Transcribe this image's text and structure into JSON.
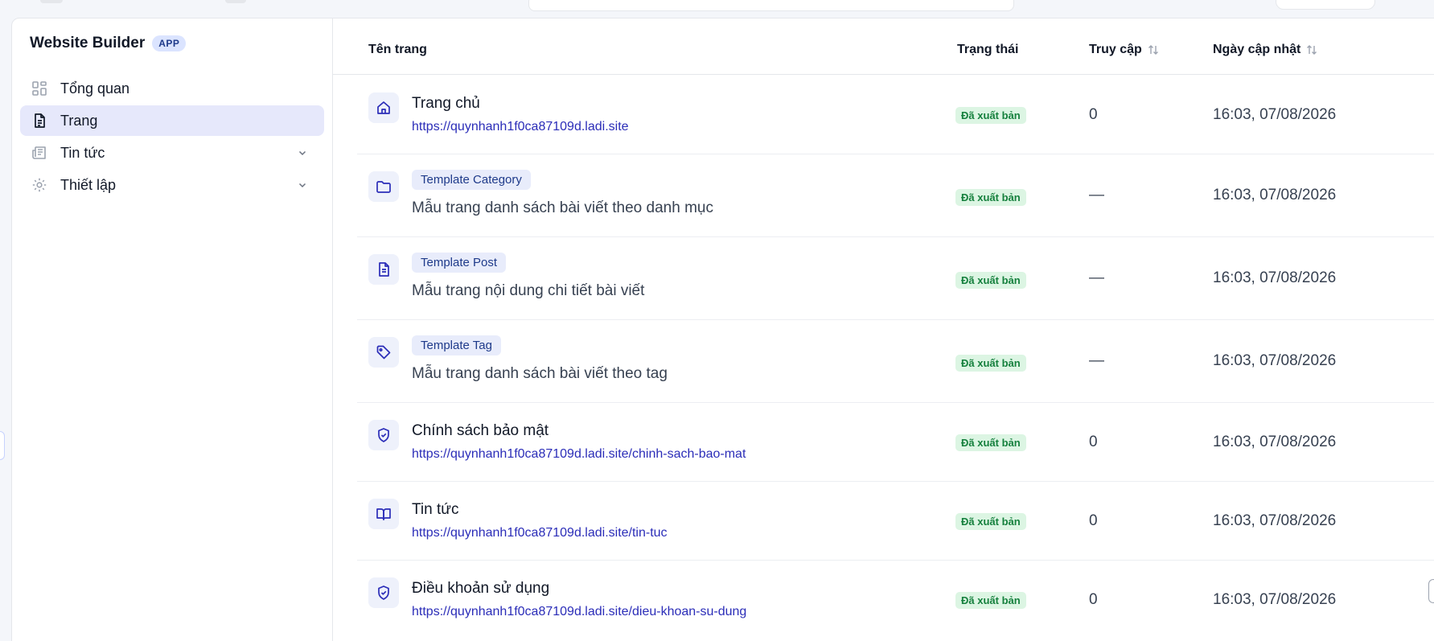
{
  "sidebar": {
    "title": "Website Builder",
    "badge": "APP",
    "items": [
      {
        "label": "Tổng quan",
        "icon": "grid-icon",
        "active": false
      },
      {
        "label": "Trang",
        "icon": "document-icon",
        "active": true
      },
      {
        "label": "Tin tức",
        "icon": "newspaper-icon",
        "active": false
      },
      {
        "label": "Thiết lập",
        "icon": "gear-icon",
        "active": false
      }
    ]
  },
  "table": {
    "headers": {
      "name": "Tên trang",
      "status": "Trạng thái",
      "visits": "Truy cập",
      "updated": "Ngày cập nhật"
    },
    "rows": [
      {
        "icon": "home-icon",
        "title": "Trang chủ",
        "url": "https://quynhanh1f0ca87109d.ladi.site",
        "status": "Đã xuất bản",
        "visits": "0",
        "updated": "16:03, 07/08/2026"
      },
      {
        "icon": "folder-icon",
        "tag": "Template Category",
        "desc": "Mẫu trang danh sách bài viết theo danh mục",
        "status": "Đã xuất bản",
        "visits": "—",
        "updated": "16:03, 07/08/2026"
      },
      {
        "icon": "file-text-icon",
        "tag": "Template Post",
        "desc": "Mẫu trang nội dung chi tiết bài viết",
        "status": "Đã xuất bản",
        "visits": "—",
        "updated": "16:03, 07/08/2026"
      },
      {
        "icon": "tag-icon",
        "tag": "Template Tag",
        "desc": "Mẫu trang danh sách bài viết theo tag",
        "status": "Đã xuất bản",
        "visits": "—",
        "updated": "16:03, 07/08/2026"
      },
      {
        "icon": "shield-check-icon",
        "title": "Chính sách bảo mật",
        "url": "https://quynhanh1f0ca87109d.ladi.site/chinh-sach-bao-mat",
        "status": "Đã xuất bản",
        "visits": "0",
        "updated": "16:03, 07/08/2026"
      },
      {
        "icon": "book-open-icon",
        "title": "Tin tức",
        "url": "https://quynhanh1f0ca87109d.ladi.site/tin-tuc",
        "status": "Đã xuất bản",
        "visits": "0",
        "updated": "16:03, 07/08/2026"
      },
      {
        "icon": "shield-check-icon",
        "title": "Điều khoản sử dụng",
        "url": "https://quynhanh1f0ca87109d.ladi.site/dieu-khoan-su-dung",
        "status": "Đã xuất bản",
        "visits": "0",
        "updated": "16:03, 07/08/2026"
      }
    ]
  },
  "colors": {
    "accent": "#2b2db8",
    "active_nav_bg": "#e6e8fb",
    "status_green": "#15803d",
    "status_green_bg": "#dcf5e3"
  }
}
